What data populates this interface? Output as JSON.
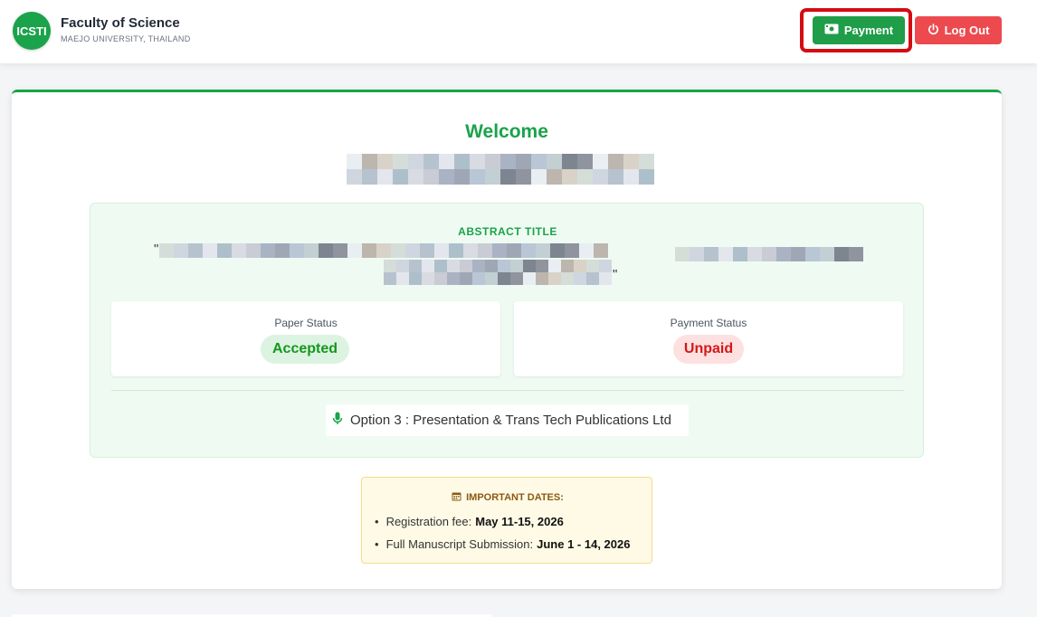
{
  "header": {
    "logo_text": "ICSTI",
    "brand_title": "Faculty of Science",
    "brand_subtitle": "MAEJO UNIVERSITY, THAILAND",
    "payment_label": "Payment",
    "logout_label": "Log Out",
    "colors": {
      "brand": "#1aa34a",
      "payment": "#1f9d48",
      "logout": "#ec4a4f",
      "highlight": "#d50b12"
    }
  },
  "main": {
    "welcome": "Welcome",
    "abstract": {
      "label": "ABSTRACT TITLE",
      "quote_open": "\"",
      "quote_close": "\""
    },
    "paper_status": {
      "label": "Paper Status",
      "value": "Accepted"
    },
    "payment_status": {
      "label": "Payment Status",
      "value": "Unpaid"
    },
    "option_text": "Option 3 : Presentation & Trans Tech Publications Ltd",
    "important_dates": {
      "title": "IMPORTANT DATES:",
      "items": [
        {
          "label": "Registration fee:",
          "value": "May 11-15, 2026"
        },
        {
          "label": "Full Manuscript Submission:",
          "value": "June 1 - 14, 2026"
        }
      ]
    }
  }
}
